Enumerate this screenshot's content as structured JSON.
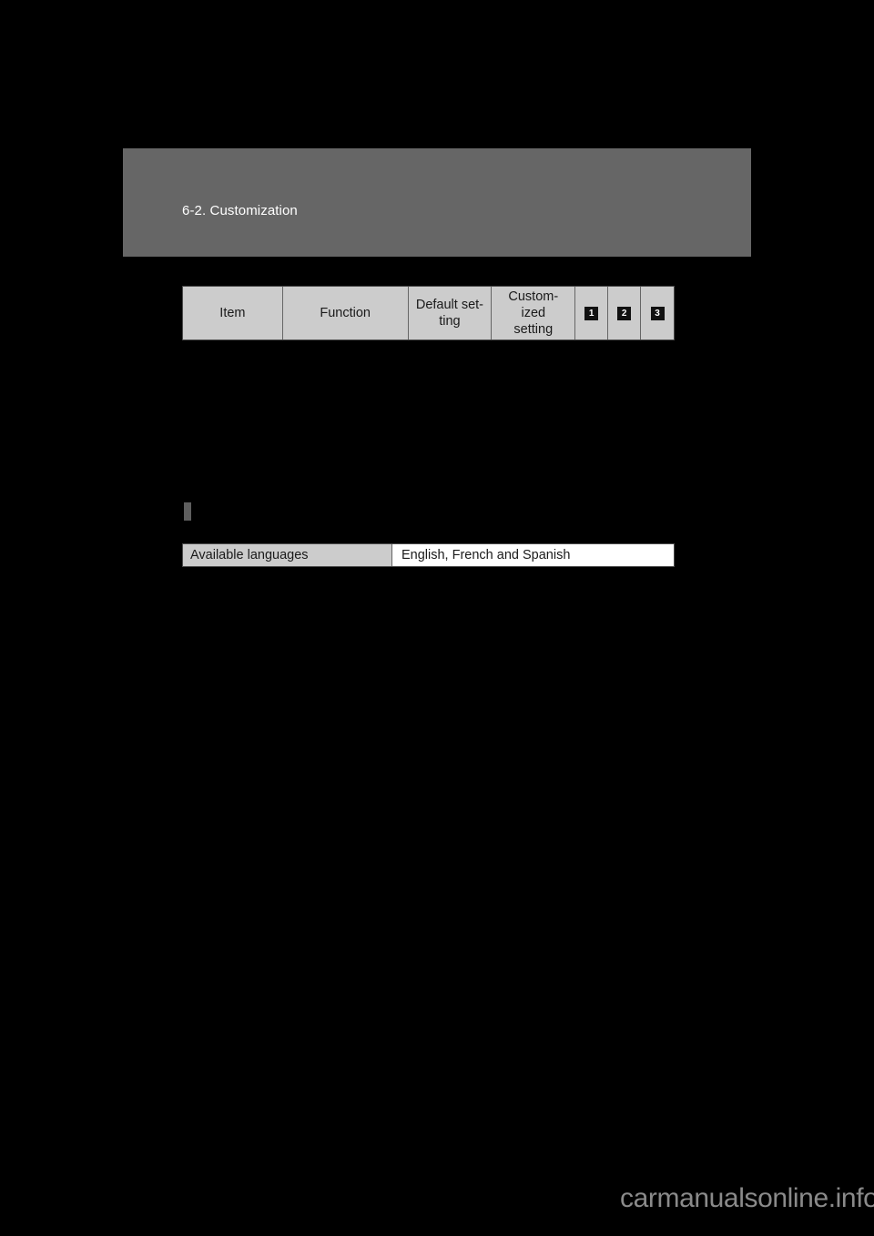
{
  "page": {
    "background_color": "#000000",
    "section_header": {
      "band_color": "#666666",
      "title": "6-2. Customization",
      "title_color": "#ffffff"
    }
  },
  "key_table": {
    "name": "customization-column-key",
    "header_background": "#cccccc",
    "border_color": "#4a4a4a",
    "columns": [
      {
        "label": "Item",
        "type": "text"
      },
      {
        "label": "Function",
        "type": "text"
      },
      {
        "label": "Default set-\nting",
        "line1": "Default set-",
        "line2": "ting",
        "type": "text"
      },
      {
        "label": "Custom-\nized\nsetting",
        "line1": "Custom-",
        "line2": "ized",
        "line3": "setting",
        "type": "text"
      },
      {
        "label": "1",
        "type": "badge"
      },
      {
        "label": "2",
        "type": "badge"
      },
      {
        "label": "3",
        "type": "badge"
      }
    ],
    "badge_style": {
      "background": "#111111",
      "color": "#ffffff"
    }
  },
  "section_marker": {
    "name": "section-bullet",
    "color": "#5e5e5e"
  },
  "languages_table": {
    "name": "available-languages",
    "label": "Available languages",
    "value": "English, French and Spanish",
    "label_background": "#cccccc",
    "value_background": "#ffffff"
  },
  "watermark": {
    "text": "carmanualsonline.info",
    "color": "#8a8a8a"
  }
}
